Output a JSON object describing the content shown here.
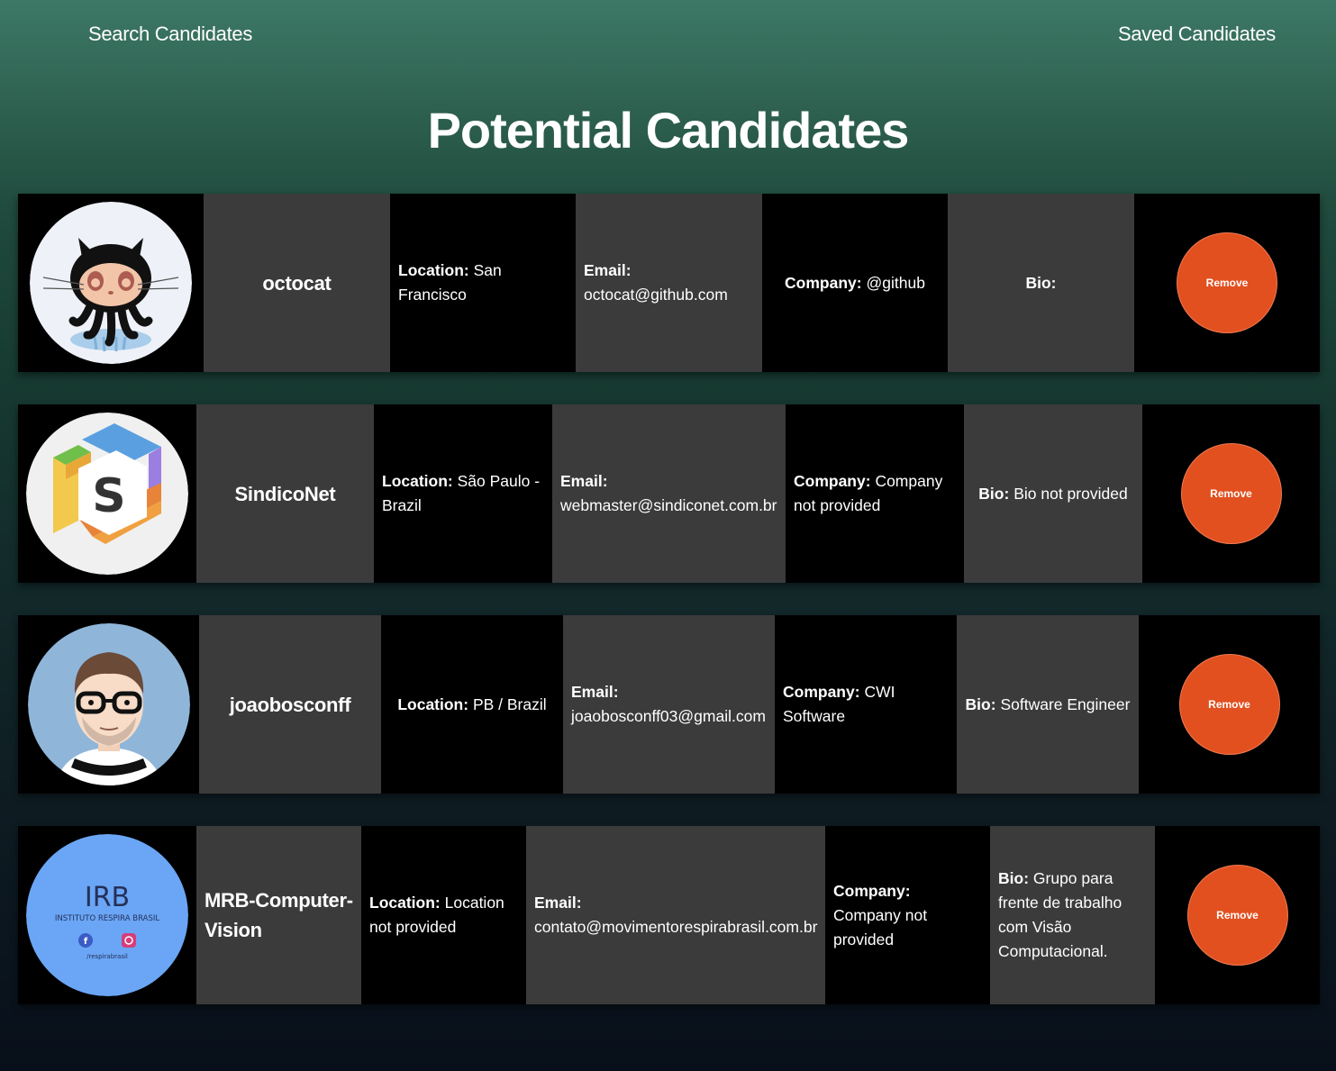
{
  "nav": {
    "search_label": "Search Candidates",
    "saved_label": "Saved Candidates"
  },
  "page_title": "Potential Candidates",
  "candidates": [
    {
      "username": "octocat",
      "location_label": "Location:",
      "location": "San Francisco",
      "email_label": "Email:",
      "email": "octocat@github.com",
      "company_label": "Company:",
      "company": "@github",
      "bio_label": "Bio:",
      "bio": "",
      "remove_label": "Remove",
      "avatar_icon": "octocat-avatar-icon"
    },
    {
      "username": "SindicoNet",
      "location_label": "Location:",
      "location": "São Paulo - Brazil",
      "email_label": "Email:",
      "email": "webmaster@sindiconet.com.br",
      "company_label": "Company:",
      "company": "Company not provided",
      "bio_label": "Bio:",
      "bio": "Bio not provided",
      "remove_label": "Remove",
      "avatar_icon": "sindiconet-logo-icon"
    },
    {
      "username": "joaobosconff",
      "location_label": "Location:",
      "location": "PB / Brazil",
      "email_label": "Email:",
      "email": "joaobosconff03@gmail.com",
      "company_label": "Company:",
      "company": "CWI Software",
      "bio_label": "Bio:",
      "bio": "Software Engineer",
      "remove_label": "Remove",
      "avatar_icon": "cartoon-person-avatar-icon"
    },
    {
      "username": "MRB-Computer-Vision",
      "location_label": "Location:",
      "location": "Location not provided",
      "email_label": "Email:",
      "email": "contato@movimentorespirabrasil.com.br",
      "company_label": "Company:",
      "company": "Company not provided",
      "bio_label": "Bio:",
      "bio": "Grupo para frente de trabalho com Visão Computacional.",
      "remove_label": "Remove",
      "avatar_icon": "irb-logo-icon",
      "avatar_text": {
        "logo": "IRB",
        "name": "INSTITUTO RESPIRA BRASIL",
        "handle": "/respirabrasil"
      }
    }
  ],
  "colors": {
    "remove_button": "#e2501f",
    "cell_dark": "#000000",
    "cell_gray": "#3b3b3b",
    "bg_top": "#3d7866",
    "bg_bottom": "#080f1a"
  }
}
